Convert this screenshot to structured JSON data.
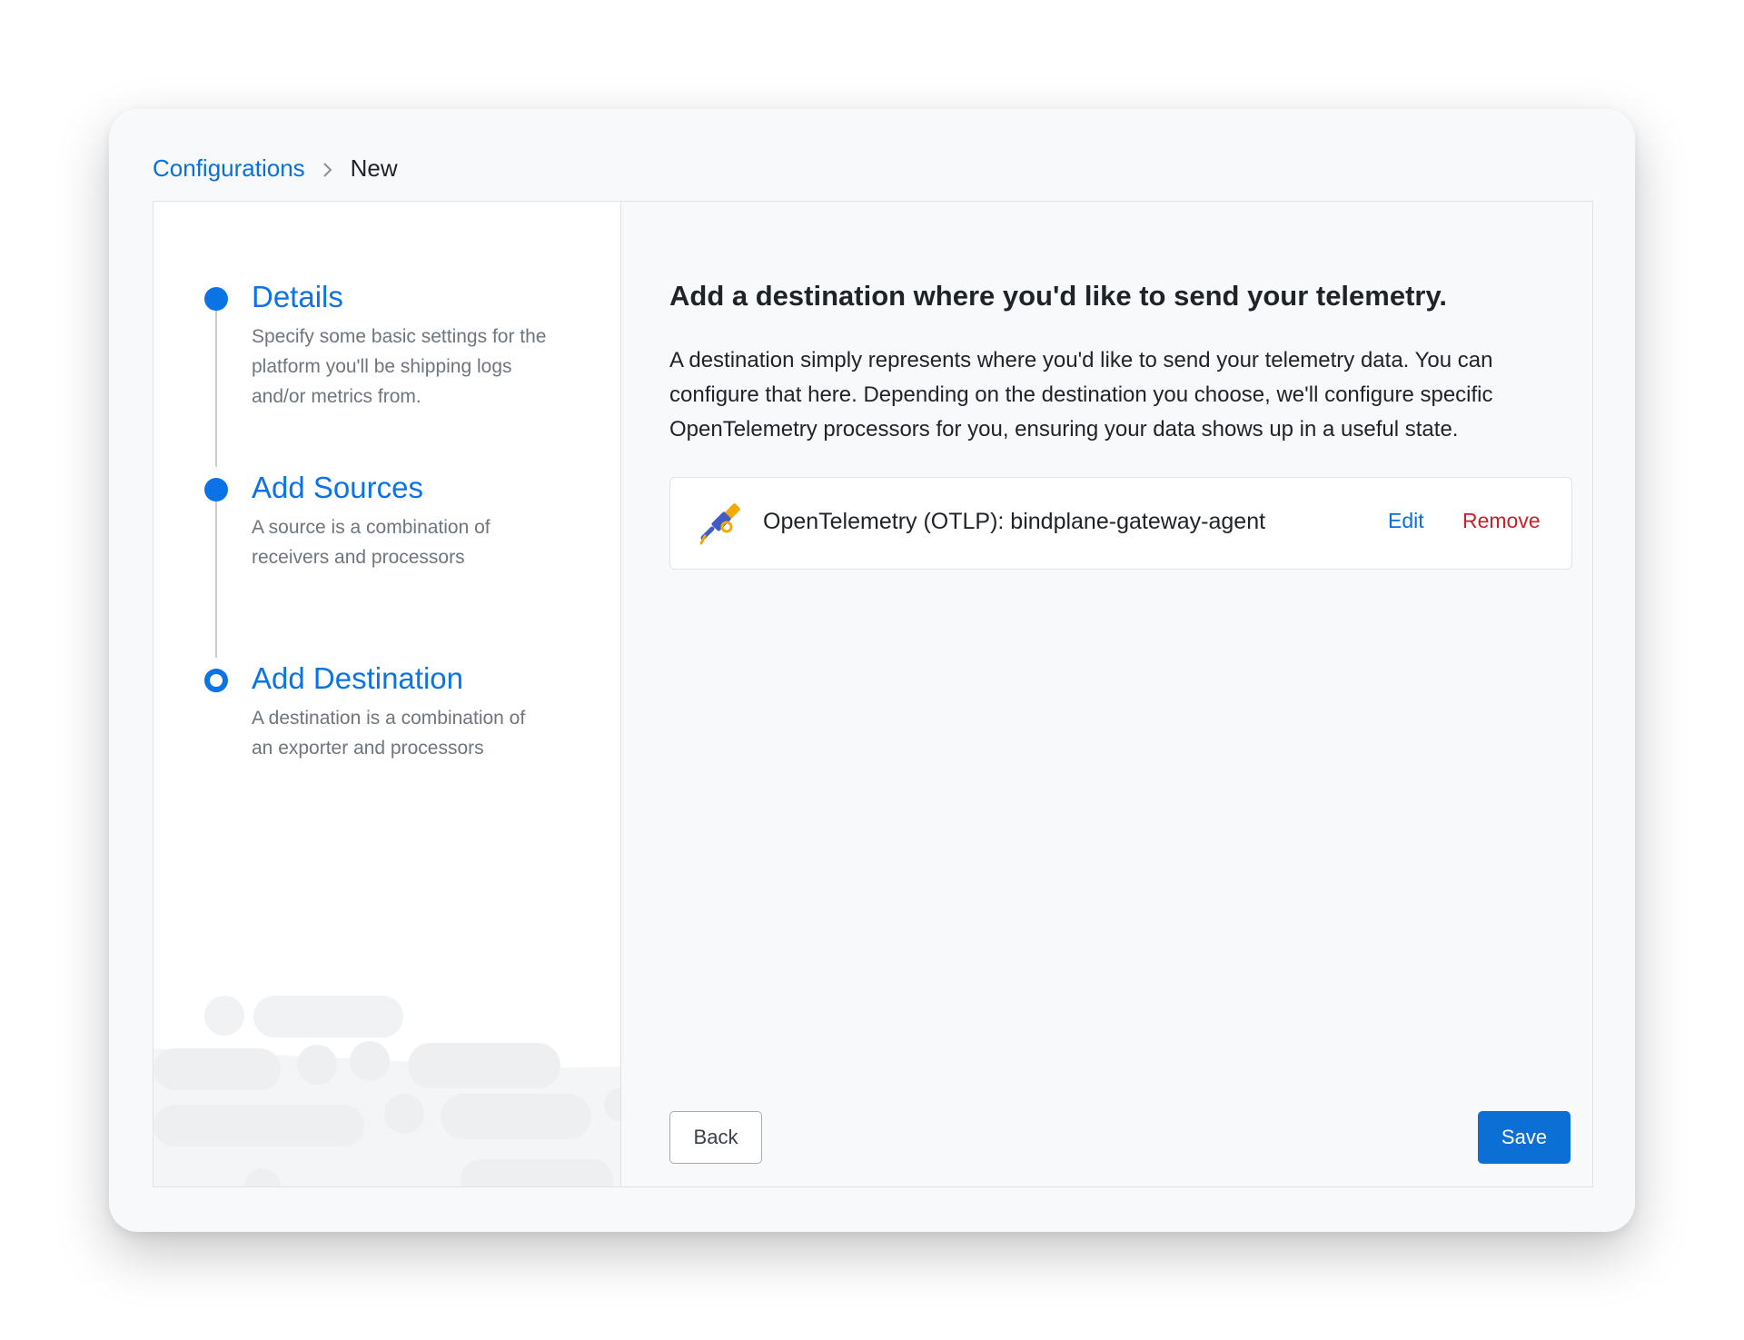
{
  "breadcrumb": {
    "parent": "Configurations",
    "current": "New"
  },
  "steps": [
    {
      "title": "Details",
      "description": "Specify some basic settings for the platform you'll be shipping logs and/or metrics from.",
      "state": "complete"
    },
    {
      "title": "Add Sources",
      "description": "A source is a combination of receivers and processors",
      "state": "complete"
    },
    {
      "title": "Add Destination",
      "description": "A destination is a combination of an exporter and processors",
      "state": "current"
    }
  ],
  "main": {
    "heading": "Add a destination where you'd like to send your telemetry.",
    "description": "A destination simply represents where you'd like to send your telemetry data. You can configure that here. Depending on the destination you choose, we'll configure specific OpenTelemetry processors for you, ensuring your data shows up in a useful state.",
    "destination": {
      "icon": "opentelemetry-telescope-icon",
      "name": "OpenTelemetry (OTLP): bindplane-gateway-agent",
      "edit_label": "Edit",
      "remove_label": "Remove"
    }
  },
  "actions": {
    "back_label": "Back",
    "save_label": "Save"
  },
  "colors": {
    "accent": "#0c73e6",
    "danger": "#c8202c",
    "muted_text": "#6e757c"
  }
}
